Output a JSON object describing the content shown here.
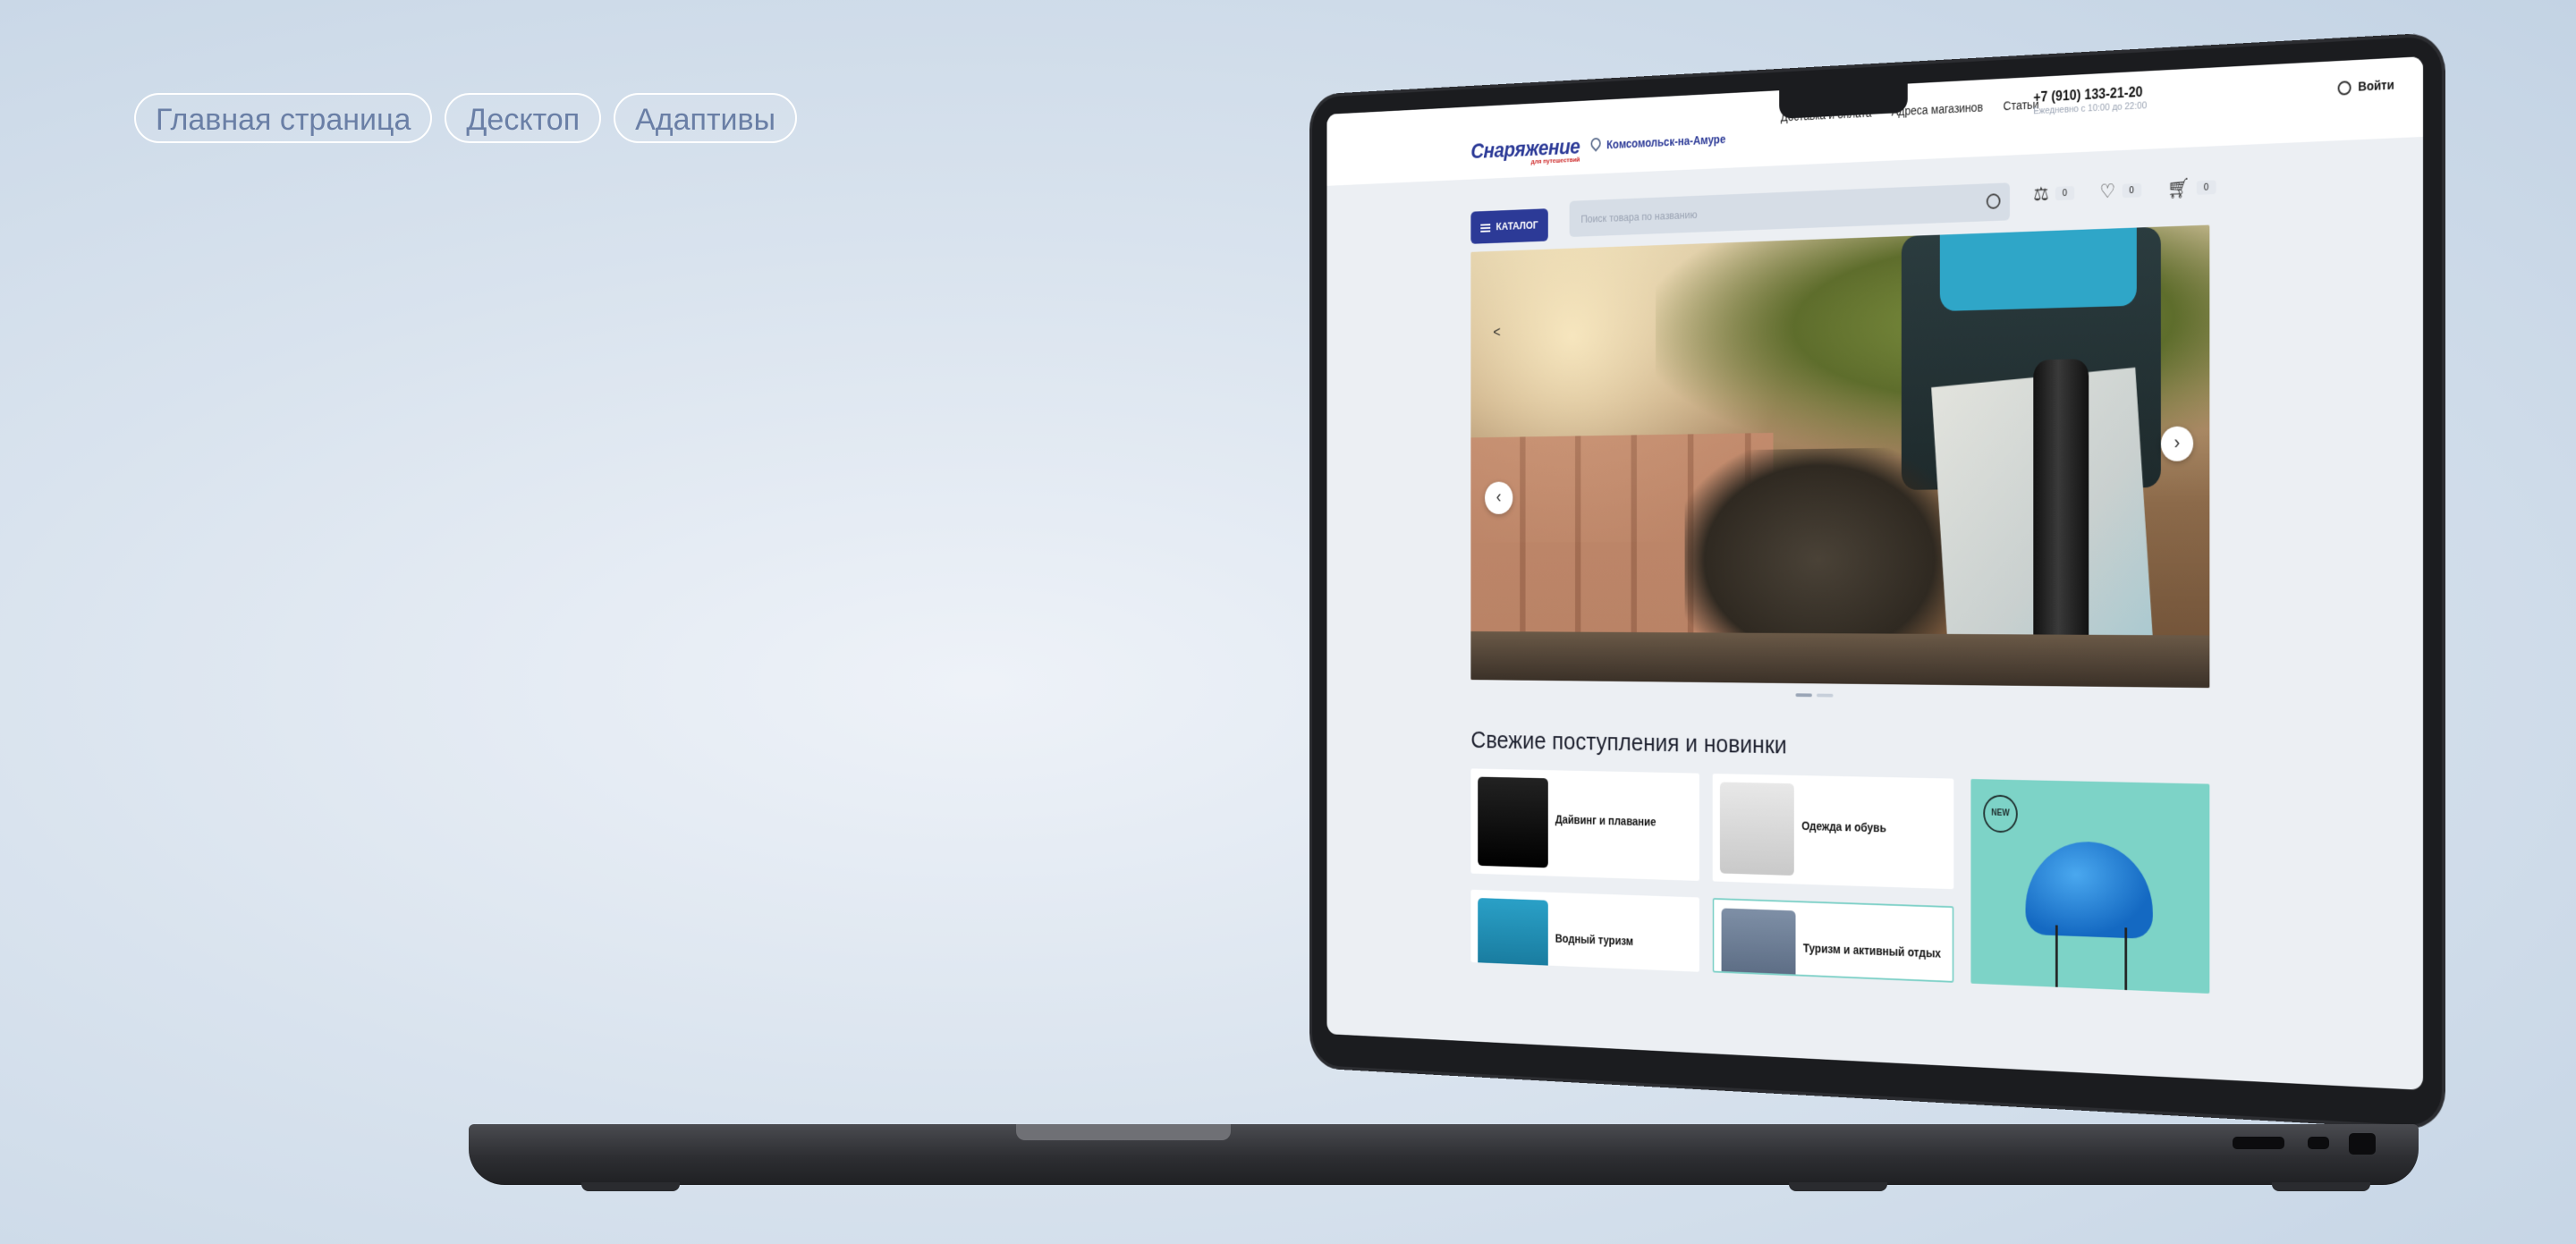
{
  "pills": [
    "Главная страница",
    "Десктоп",
    "Адаптивы"
  ],
  "site": {
    "logo": "Снаряжение",
    "logo_sub": "для путешествий",
    "city": "Комсомольск-на-Амуре",
    "nav": [
      "Доставка и оплата",
      "Адреса магазинов",
      "Статьи"
    ],
    "phone": "+7 (910) 133-21-20",
    "hours": "Ежедневно с 10:00 до 22:00",
    "login": "Войти",
    "catalog": "КАТАЛОГ",
    "search_placeholder": "Поиск товара по названию",
    "counters": {
      "compare": "0",
      "favorites": "0",
      "cart": "0"
    },
    "section_title": "Свежие поступления и новинки",
    "cards": [
      "Дайвинг и плавание",
      "Одежда и обувь",
      "Водный туризм",
      "Туризм и активный отдых"
    ],
    "promo_badge": "NEW"
  }
}
